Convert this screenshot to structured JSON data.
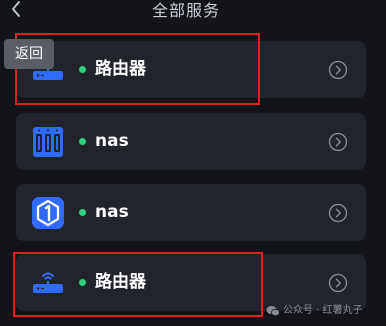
{
  "header": {
    "title": "全部服务",
    "back_icon": "chevron-left-icon"
  },
  "tooltip": {
    "label": "返回"
  },
  "services": [
    {
      "name": "路由器",
      "icon": "router-icon",
      "status": "online",
      "status_color": "#2ecf7e",
      "highlighted": true
    },
    {
      "name": "nas",
      "icon": "nas-server-icon",
      "status": "online",
      "status_color": "#2ecf7e",
      "highlighted": false
    },
    {
      "name": "nas",
      "icon": "nas-app-icon",
      "status": "online",
      "status_color": "#2ecf7e",
      "highlighted": false
    },
    {
      "name": "路由器",
      "icon": "router-icon",
      "status": "online",
      "status_color": "#2ecf7e",
      "highlighted": true
    }
  ],
  "watermark": {
    "text": "公众号 · 红薯丸子",
    "icon": "wechat-icon"
  },
  "colors": {
    "background": "#121419",
    "card": "#21242b",
    "accent_blue": "#2f6bff",
    "highlight_red": "#e02020",
    "status_green": "#2ecf7e"
  }
}
